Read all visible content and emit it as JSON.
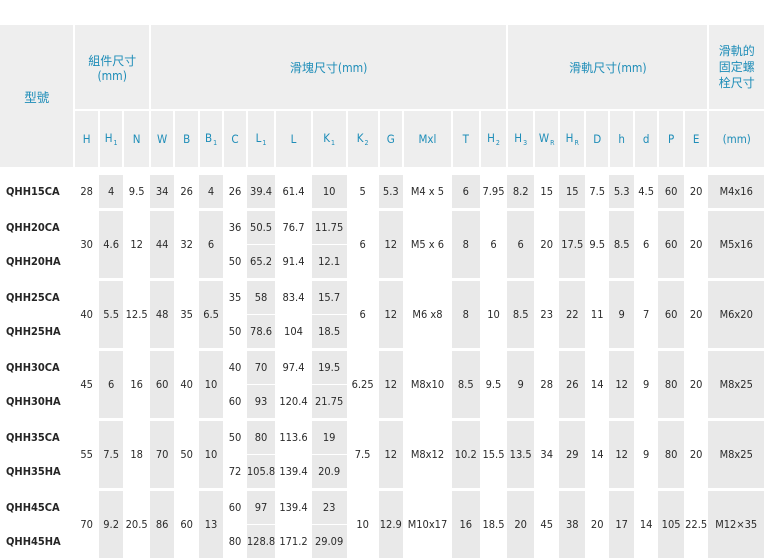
{
  "header": {
    "model": "型號",
    "assembly": "組件尺寸\n(mm)",
    "block": "滑塊尺寸(mm)",
    "rail": "滑軌尺寸(mm)",
    "bolt": "滑軌的\n固定螺\n栓尺寸",
    "bolt_unit": "(mm)"
  },
  "columns": [
    {
      "base": "H",
      "sub": ""
    },
    {
      "base": "H",
      "sub": "1"
    },
    {
      "base": "N",
      "sub": ""
    },
    {
      "base": "W",
      "sub": ""
    },
    {
      "base": "B",
      "sub": ""
    },
    {
      "base": "B",
      "sub": "1"
    },
    {
      "base": "C",
      "sub": ""
    },
    {
      "base": "L",
      "sub": "1"
    },
    {
      "base": "L",
      "sub": ""
    },
    {
      "base": "K",
      "sub": "1"
    },
    {
      "base": "K",
      "sub": "2"
    },
    {
      "base": "G",
      "sub": ""
    },
    {
      "base": "Mxl",
      "sub": ""
    },
    {
      "base": "T",
      "sub": ""
    },
    {
      "base": "H",
      "sub": "2"
    },
    {
      "base": "H",
      "sub": "3"
    },
    {
      "base": "W",
      "sub": "R"
    },
    {
      "base": "H",
      "sub": "R"
    },
    {
      "base": "D",
      "sub": ""
    },
    {
      "base": "h",
      "sub": ""
    },
    {
      "base": "d",
      "sub": ""
    },
    {
      "base": "P",
      "sub": ""
    },
    {
      "base": "E",
      "sub": ""
    }
  ],
  "rows": {
    "qhh15": {
      "models": [
        "QHH15CA"
      ],
      "shared": {
        "H": "28",
        "H1": "4",
        "N": "9.5",
        "W": "34",
        "B": "26",
        "B1": "4",
        "K2": "5",
        "G": "5.3",
        "Mxl": "M4 x 5",
        "T": "6",
        "H2": "7.95",
        "H3": "8.2",
        "WR": "15",
        "HR": "15",
        "D": "7.5",
        "h": "5.3",
        "d": "4.5",
        "P": "60",
        "E": "20",
        "bolt": "M4x16"
      },
      "variants": [
        {
          "C": "26",
          "L1": "39.4",
          "L": "61.4",
          "K1": "10"
        }
      ]
    },
    "qhh20": {
      "models": [
        "QHH20CA",
        "QHH20HA"
      ],
      "shared": {
        "H": "30",
        "H1": "4.6",
        "N": "12",
        "W": "44",
        "B": "32",
        "B1": "6",
        "K2": "6",
        "G": "12",
        "Mxl": "M5 x 6",
        "T": "8",
        "H2": "6",
        "H3": "6",
        "WR": "20",
        "HR": "17.5",
        "D": "9.5",
        "h": "8.5",
        "d": "6",
        "P": "60",
        "E": "20",
        "bolt": "M5x16"
      },
      "variants": [
        {
          "C": "36",
          "L1": "50.5",
          "L": "76.7",
          "K1": "11.75"
        },
        {
          "C": "50",
          "L1": "65.2",
          "L": "91.4",
          "K1": "12.1"
        }
      ]
    },
    "qhh25": {
      "models": [
        "QHH25CA",
        "QHH25HA"
      ],
      "shared": {
        "H": "40",
        "H1": "5.5",
        "N": "12.5",
        "W": "48",
        "B": "35",
        "B1": "6.5",
        "K2": "6",
        "G": "12",
        "Mxl": "M6 x8",
        "T": "8",
        "H2": "10",
        "H3": "8.5",
        "WR": "23",
        "HR": "22",
        "D": "11",
        "h": "9",
        "d": "7",
        "P": "60",
        "E": "20",
        "bolt": "M6x20"
      },
      "variants": [
        {
          "C": "35",
          "L1": "58",
          "L": "83.4",
          "K1": "15.7"
        },
        {
          "C": "50",
          "L1": "78.6",
          "L": "104",
          "K1": "18.5"
        }
      ]
    },
    "qhh30": {
      "models": [
        "QHH30CA",
        "QHH30HA"
      ],
      "shared": {
        "H": "45",
        "H1": "6",
        "N": "16",
        "W": "60",
        "B": "40",
        "B1": "10",
        "K2": "6.25",
        "G": "12",
        "Mxl": "M8x10",
        "T": "8.5",
        "H2": "9.5",
        "H3": "9",
        "WR": "28",
        "HR": "26",
        "D": "14",
        "h": "12",
        "d": "9",
        "P": "80",
        "E": "20",
        "bolt": "M8x25"
      },
      "variants": [
        {
          "C": "40",
          "L1": "70",
          "L": "97.4",
          "K1": "19.5"
        },
        {
          "C": "60",
          "L1": "93",
          "L": "120.4",
          "K1": "21.75"
        }
      ]
    },
    "qhh35": {
      "models": [
        "QHH35CA",
        "QHH35HA"
      ],
      "shared": {
        "H": "55",
        "H1": "7.5",
        "N": "18",
        "W": "70",
        "B": "50",
        "B1": "10",
        "K2": "7.5",
        "G": "12",
        "Mxl": "M8x12",
        "T": "10.2",
        "H2": "15.5",
        "H3": "13.5",
        "WR": "34",
        "HR": "29",
        "D": "14",
        "h": "12",
        "d": "9",
        "P": "80",
        "E": "20",
        "bolt": "M8x25"
      },
      "variants": [
        {
          "C": "50",
          "L1": "80",
          "L": "113.6",
          "K1": "19"
        },
        {
          "C": "72",
          "L1": "105.8",
          "L": "139.4",
          "K1": "20.9"
        }
      ]
    },
    "qhh45": {
      "models": [
        "QHH45CA",
        "QHH45HA"
      ],
      "shared": {
        "H": "70",
        "H1": "9.2",
        "N": "20.5",
        "W": "86",
        "B": "60",
        "B1": "13",
        "K2": "10",
        "G": "12.9",
        "Mxl": "M10x17",
        "T": "16",
        "H2": "18.5",
        "H3": "20",
        "WR": "45",
        "HR": "38",
        "D": "20",
        "h": "17",
        "d": "14",
        "P": "105",
        "E": "22.5",
        "bolt": "M12×35"
      },
      "variants": [
        {
          "C": "60",
          "L1": "97",
          "L": "139.4",
          "K1": "23"
        },
        {
          "C": "80",
          "L1": "128.8",
          "L": "171.2",
          "K1": "29.09"
        }
      ]
    }
  }
}
